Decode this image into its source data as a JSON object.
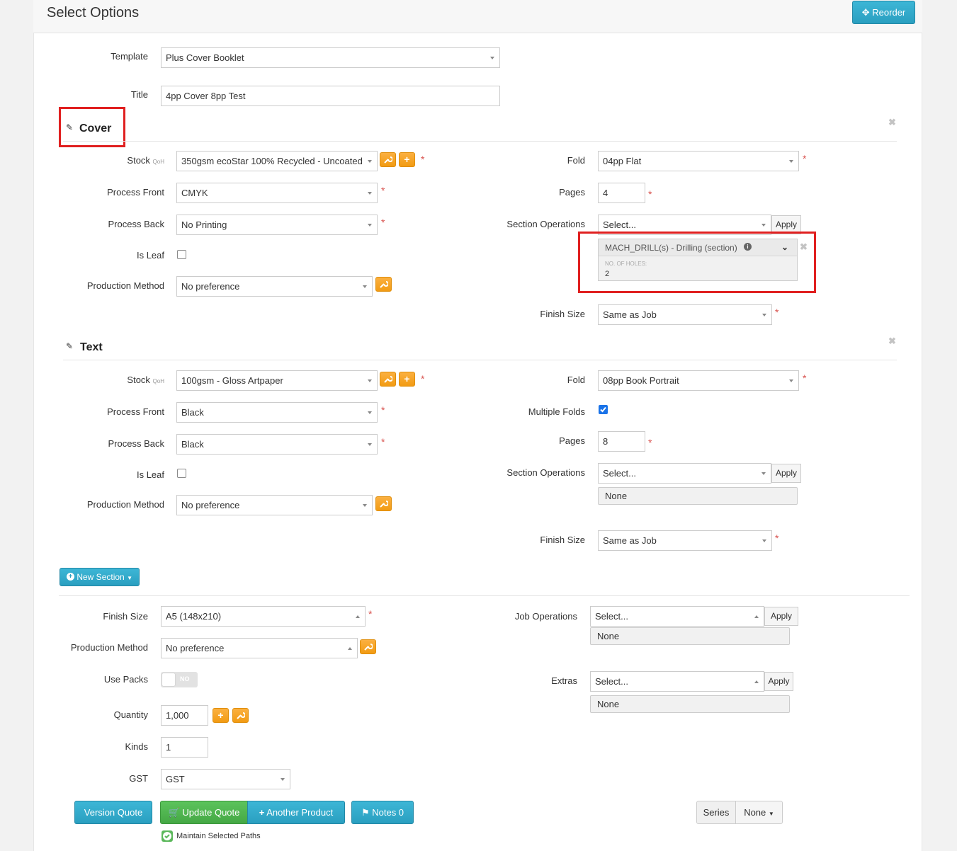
{
  "page": {
    "title": "Select Options"
  },
  "header": {
    "reorder_label": "Reorder"
  },
  "template": {
    "label": "Template",
    "value": "Plus Cover Booklet"
  },
  "title_field": {
    "label": "Title",
    "value": "4pp Cover 8pp Test"
  },
  "cover": {
    "title": "Cover",
    "stock_label": "Stock",
    "qoh_label": "QoH",
    "stock_value": "350gsm ecoStar 100% Recycled - Uncoated",
    "process_front_label": "Process Front",
    "process_front_value": "CMYK",
    "process_back_label": "Process Back",
    "process_back_value": "No Printing",
    "is_leaf_label": "Is Leaf",
    "is_leaf_checked": false,
    "production_method_label": "Production Method",
    "production_method_value": "No preference",
    "fold_label": "Fold",
    "fold_value": "04pp Flat",
    "pages_label": "Pages",
    "pages_value": "4",
    "section_ops_label": "Section Operations",
    "section_ops_select": "Select...",
    "apply_label": "Apply",
    "operation": {
      "name": "MACH_DRILL(s) - Drilling (section)",
      "param_label": "NO. OF HOLES:",
      "param_value": "2"
    },
    "finish_size_label": "Finish Size",
    "finish_size_value": "Same as Job"
  },
  "text": {
    "title": "Text",
    "stock_label": "Stock",
    "qoh_label": "QoH",
    "stock_value": "100gsm - Gloss Artpaper",
    "process_front_label": "Process Front",
    "process_front_value": "Black",
    "process_back_label": "Process Back",
    "process_back_value": "Black",
    "is_leaf_label": "Is Leaf",
    "is_leaf_checked": false,
    "production_method_label": "Production Method",
    "production_method_value": "No preference",
    "fold_label": "Fold",
    "fold_value": "08pp Book Portrait",
    "multiple_folds_label": "Multiple Folds",
    "multiple_folds_checked": true,
    "pages_label": "Pages",
    "pages_value": "8",
    "section_ops_label": "Section Operations",
    "section_ops_select": "Select...",
    "apply_label": "Apply",
    "section_ops_none": "None",
    "finish_size_label": "Finish Size",
    "finish_size_value": "Same as Job"
  },
  "new_section_label": "New Section",
  "job": {
    "finish_size_label": "Finish Size",
    "finish_size_value": "A5 (148x210)",
    "production_method_label": "Production Method",
    "production_method_value": "No preference",
    "use_packs_label": "Use Packs",
    "use_packs_state": "NO",
    "quantity_label": "Quantity",
    "quantity_value": "1,000",
    "kinds_label": "Kinds",
    "kinds_value": "1",
    "gst_label": "GST",
    "gst_value": "GST",
    "job_ops_label": "Job Operations",
    "job_ops_select": "Select...",
    "job_ops_apply": "Apply",
    "job_ops_none": "None",
    "extras_label": "Extras",
    "extras_select": "Select...",
    "extras_apply": "Apply",
    "extras_none": "None"
  },
  "footer": {
    "version_quote": "Version Quote",
    "update_quote": "Update Quote",
    "another_product": "Another Product",
    "notes": "Notes 0",
    "maintain_paths": "Maintain Selected Paths",
    "series_label": "Series",
    "series_value": "None"
  },
  "colors": {
    "accent_blue": "#2a9fc0",
    "orange": "#f29b13",
    "green": "#45a845",
    "highlight_red": "#e02020"
  }
}
